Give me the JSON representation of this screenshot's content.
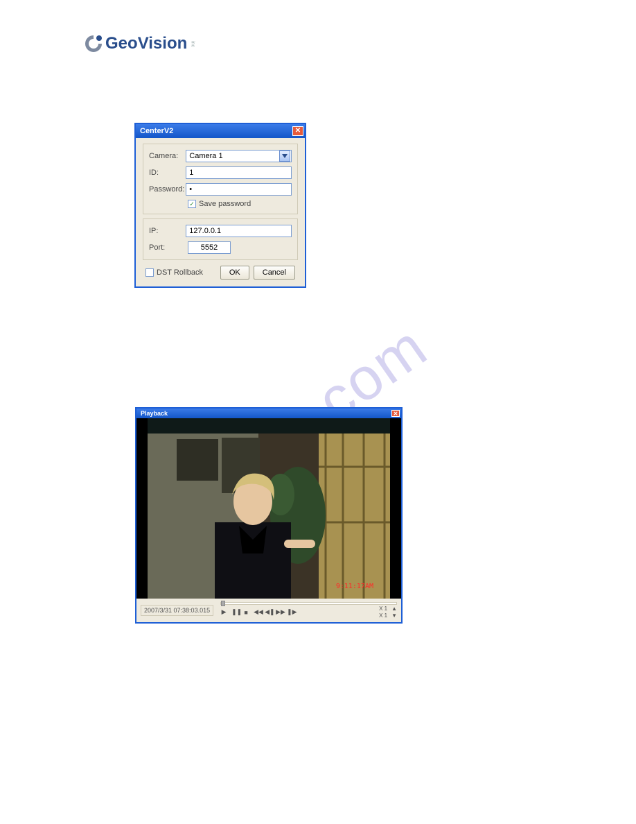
{
  "logo": {
    "geo": "Geo",
    "vision": "Vision",
    "inc": "inc"
  },
  "watermark": "hive.com",
  "dialog1": {
    "title": "CenterV2",
    "camera_label": "Camera:",
    "camera_value": "Camera 1",
    "id_label": "ID:",
    "id_value": "1",
    "password_label": "Password:",
    "password_value": "•",
    "save_password_label": "Save password",
    "save_password_checked": true,
    "ip_label": "IP:",
    "ip_value": "127.0.0.1",
    "port_label": "Port:",
    "port_value": "5552",
    "dst_label": "DST Rollback",
    "dst_checked": false,
    "ok": "OK",
    "cancel": "Cancel"
  },
  "dialog2": {
    "title": "Playback",
    "overlay_time": "9:11:17AM",
    "timestamp": "2007/3/31 07:38:03.015",
    "speed_lines": [
      "X  1",
      "X  1"
    ]
  }
}
